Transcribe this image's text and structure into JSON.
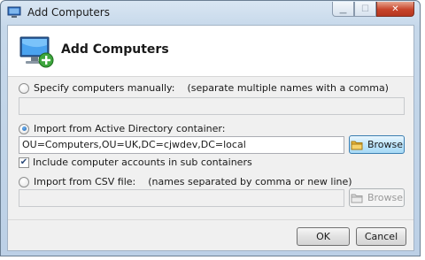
{
  "window": {
    "title": "Add Computers"
  },
  "header": {
    "title": "Add Computers"
  },
  "options": {
    "manual": {
      "label": "Specify computers manually:",
      "hint": "(separate multiple names with a comma)",
      "value": ""
    },
    "active_directory": {
      "label": "Import from Active Directory container:",
      "value": "OU=Computers,OU=UK,DC=cjwdev,DC=local",
      "browse_label": "Browse",
      "include_sub_label": "Include computer accounts in sub containers"
    },
    "csv": {
      "label": "Import from CSV file:",
      "hint": "(names separated by comma or new line)",
      "value": "",
      "browse_label": "Browse"
    }
  },
  "footer": {
    "ok_label": "OK",
    "cancel_label": "Cancel"
  },
  "icons": {
    "check_glyph": "✔",
    "minimize_glyph": "▁",
    "maximize_glyph": "☐",
    "close_glyph": "✕"
  },
  "colors": {
    "accent": "#3c7fb1",
    "close": "#c7442a",
    "folder": "#e8b73a"
  }
}
